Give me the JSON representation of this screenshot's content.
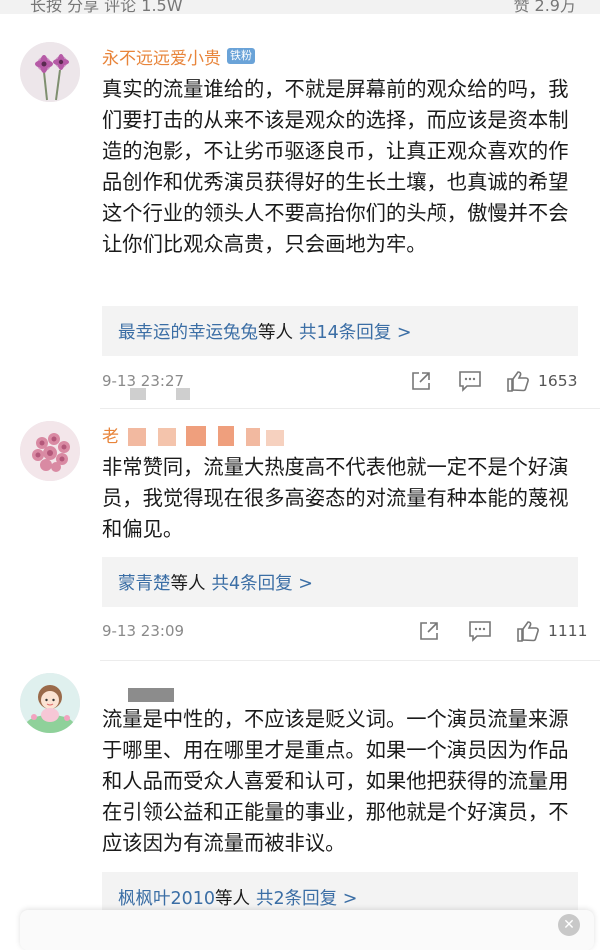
{
  "top_bar": {
    "left_partial": "长按 分享  评论 1.5W",
    "right_partial": "赞 2.9万"
  },
  "comments": [
    {
      "username": "永不远远爱小贵",
      "badge": "铁粉",
      "text": "真实的流量谁给的，不就是屏幕前的观众给的吗，我们要打击的从来不该是观众的选择，而应该是资本制造的泡影，不让劣币驱逐良币，让真正观众喜欢的作品创作和优秀演员获得好的生长土壤，也真诚的希望这个行业的领头人不要高抬你们的头颅，傲慢并不会让你们比观众高贵，只会画地为牢。",
      "reply_who": "最幸运的幸运兔兔",
      "reply_suffix": "等人",
      "reply_count": "共14条回复 >",
      "time": "9-13 23:27",
      "likes": "1653"
    },
    {
      "username": "老",
      "text": "非常赞同，流量大热度高不代表他就一定不是个好演员，我觉得现在很多高姿态的对流量有种本能的蔑视和偏见。",
      "reply_who": "蒙青楚",
      "reply_suffix": "等人",
      "reply_count": "共4条回复 >",
      "time": "9-13 23:09",
      "likes": "1111"
    },
    {
      "username": "",
      "text": "流量是中性的，不应该是贬义词。一个演员流量来源于哪里、用在哪里才是重点。如果一个演员因为作品和人品而受众人喜爱和认可，如果他把获得的流量用在引领公益和正能量的事业，那他就是个好演员，不应该因为有流量而被非议。",
      "reply_who": "枫枫叶2010",
      "reply_suffix": "等人",
      "reply_count": "共2条回复 >"
    }
  ],
  "colors": {
    "username": "#e8843a",
    "link": "#3b6ea5",
    "reply_bg": "#f3f3f3",
    "meta": "#8a8a8a"
  },
  "icons": [
    "share-icon",
    "comment-icon",
    "like-icon",
    "close-icon"
  ]
}
